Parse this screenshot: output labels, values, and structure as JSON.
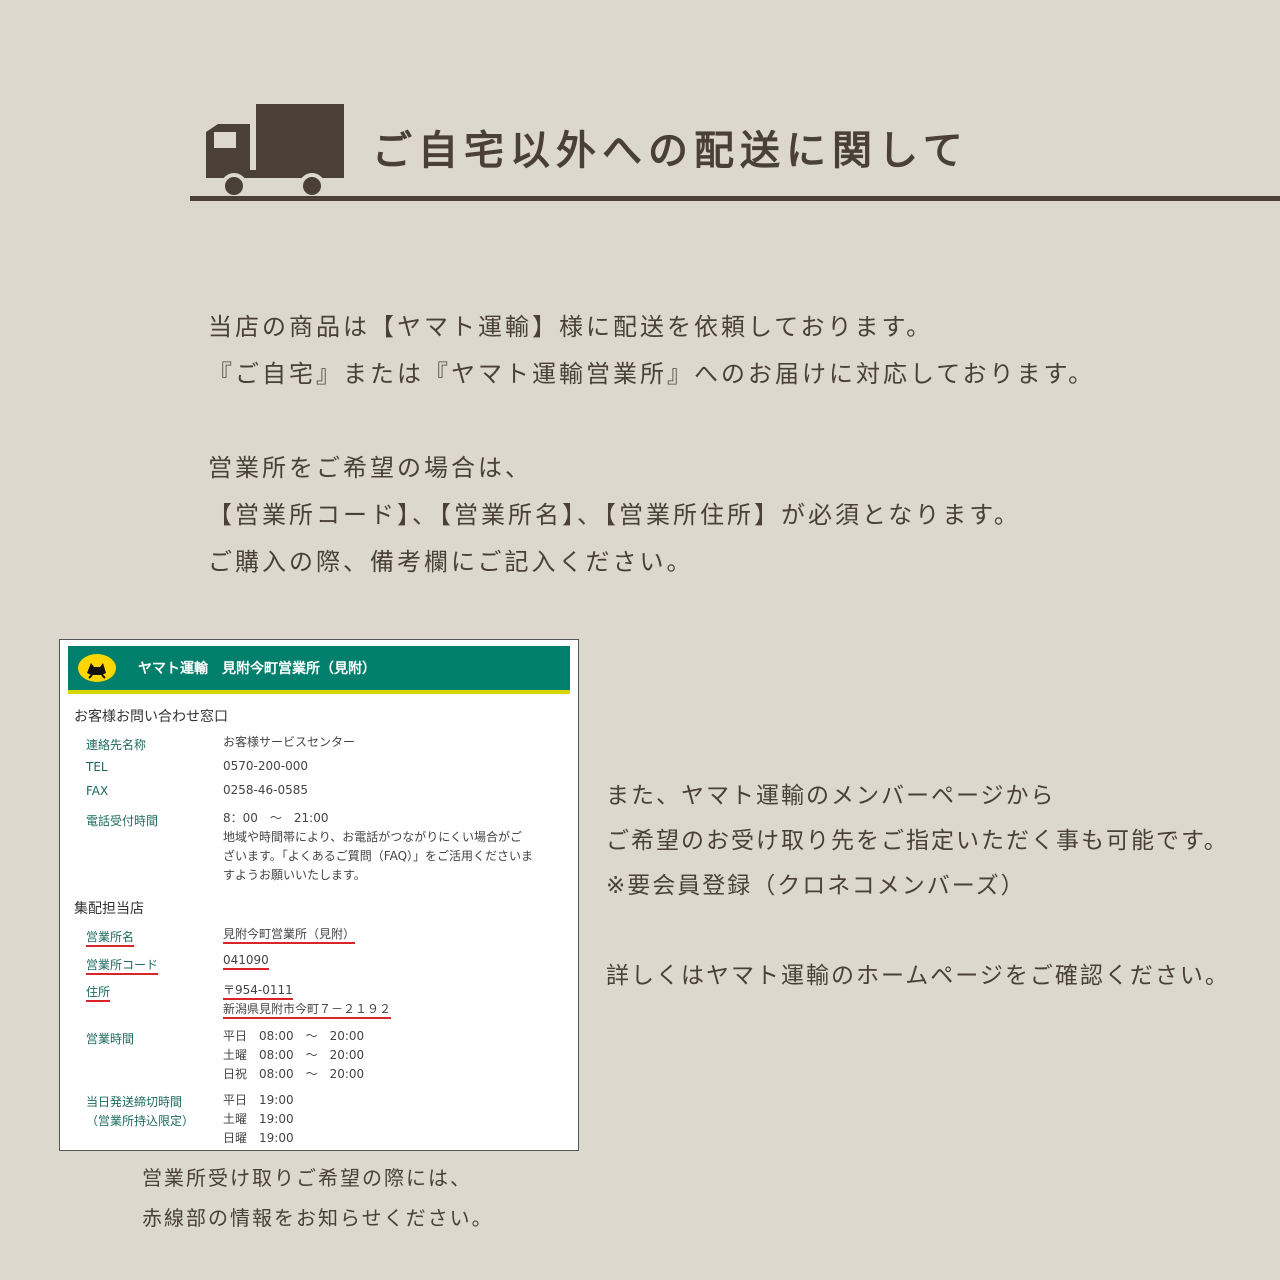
{
  "header": {
    "title": "ご自宅以外への配送に関して",
    "icon": "truck-icon"
  },
  "intro": {
    "lines": [
      "当店の商品は【ヤマト運輸】様に配送を依頼しております。",
      "『ご自宅』または『ヤマト運輸営業所』へのお届けに対応しております。",
      "",
      "営業所をご希望の場合は、",
      "【営業所コード】、【営業所名】、【営業所住所】が必須となります。",
      "ご購入の際、備考欄にご記入ください。"
    ]
  },
  "screenshot": {
    "banner_title": "ヤマト運輸　見附今町営業所（見附）",
    "contact_heading": "お客様お問い合わせ窓口",
    "contact_rows": [
      {
        "label": "連絡先名称",
        "value": "お客様サービスセンター"
      },
      {
        "label": "TEL",
        "value": "0570-200-000"
      },
      {
        "label": "FAX",
        "value": "0258-46-0585"
      },
      {
        "label": "電話受付時間",
        "value": "8：00　～　21:00"
      }
    ],
    "note_lines": [
      "地域や時間帯により、お電話がつながりにくい場合がご",
      "ざいます。「よくあるご質問（FAQ）」をご活用くださいま",
      "すようお願いいたします。"
    ],
    "branch_heading": "集配担当店",
    "branch_name_label": "営業所名",
    "branch_name": "見附今町営業所（見附）",
    "branch_code_label": "営業所コード",
    "branch_code": "041090",
    "address_label": "住所",
    "postal": "〒954-0111",
    "address": "新潟県見附市今町７－２１９２",
    "hours_label": "営業時間",
    "hours": [
      "平日　08:00　～　20:00",
      "土曜　08:00　～　20:00",
      "日祝　08:00　～　20:00"
    ],
    "cutoff_label_1": "当日発送締切時間",
    "cutoff_label_2": "（営業所持込限定）",
    "cutoff": [
      "平日　19:00",
      "土曜　19:00",
      "日曜　19:00"
    ]
  },
  "caption": {
    "lines": [
      "営業所受け取りご希望の際には、",
      "赤線部の情報をお知らせください。"
    ]
  },
  "side_note": {
    "lines": [
      "また、ヤマト運輸のメンバーページから",
      "ご希望のお受け取り先をご指定いただく事も可能です。",
      "※要会員登録（クロネコメンバーズ）",
      "",
      "詳しくはヤマト運輸のホームページをご確認ください。"
    ]
  },
  "colors": {
    "background": "#dcd8ce",
    "text": "#4a4038",
    "yamato_green": "#00806c",
    "underline_red": "#d9252a"
  }
}
